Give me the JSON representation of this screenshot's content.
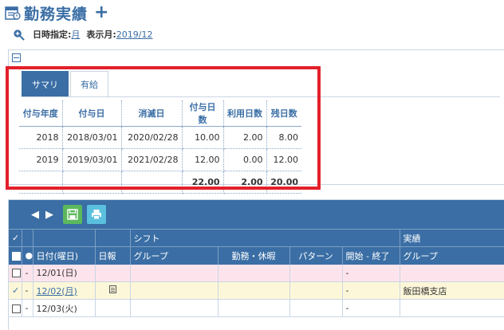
{
  "header": {
    "title": "勤務実績",
    "filter_label": "日時指定:",
    "filter_value": "月",
    "month_label": "表示月:",
    "month_value": "2019/12"
  },
  "summary": {
    "tabs": [
      {
        "label": "サマリ",
        "active": true
      },
      {
        "label": "有給",
        "active": false
      }
    ],
    "columns": [
      "付与年度",
      "付与日",
      "消滅日",
      "付与日数",
      "利用日数",
      "残日数"
    ],
    "rows": [
      [
        "2018",
        "2018/03/01",
        "2020/02/28",
        "10.00",
        "2.00",
        "8.00"
      ],
      [
        "2019",
        "2019/03/01",
        "2021/02/28",
        "12.00",
        "0.00",
        "12.00"
      ]
    ],
    "totals": [
      "",
      "",
      "",
      "22.00",
      "2.00",
      "20.00"
    ]
  },
  "grid": {
    "group_headers": {
      "shift": "シフト",
      "actual": "実績"
    },
    "columns": [
      "日付(曜日)",
      "日報",
      "グループ",
      "勤務・休暇",
      "パターン",
      "開始 - 終了",
      "グループ"
    ],
    "rows": [
      {
        "checked": false,
        "flag": "-",
        "date": "12/01(日)",
        "link": false,
        "report_icon": false,
        "group": "",
        "work": "",
        "pattern": "",
        "time": "-",
        "actual_group": "",
        "style": "pink"
      },
      {
        "checked": true,
        "flag": "-",
        "date": "12/02(月)",
        "link": true,
        "report_icon": true,
        "group": "",
        "work": "",
        "pattern": "",
        "time": "-",
        "actual_group": "飯田橋支店",
        "style": "yellow"
      },
      {
        "checked": false,
        "flag": "-",
        "date": "12/03(火)",
        "link": false,
        "report_icon": false,
        "group": "",
        "work": "",
        "pattern": "",
        "time": "-",
        "actual_group": "",
        "style": "white"
      }
    ]
  },
  "colors": {
    "primary": "#3a6ea5",
    "highlight": "#e3202a",
    "save": "#5cb85c",
    "print": "#5bc0de",
    "pink_row": "#fde4ec",
    "yellow_row": "#fdf7d9"
  }
}
